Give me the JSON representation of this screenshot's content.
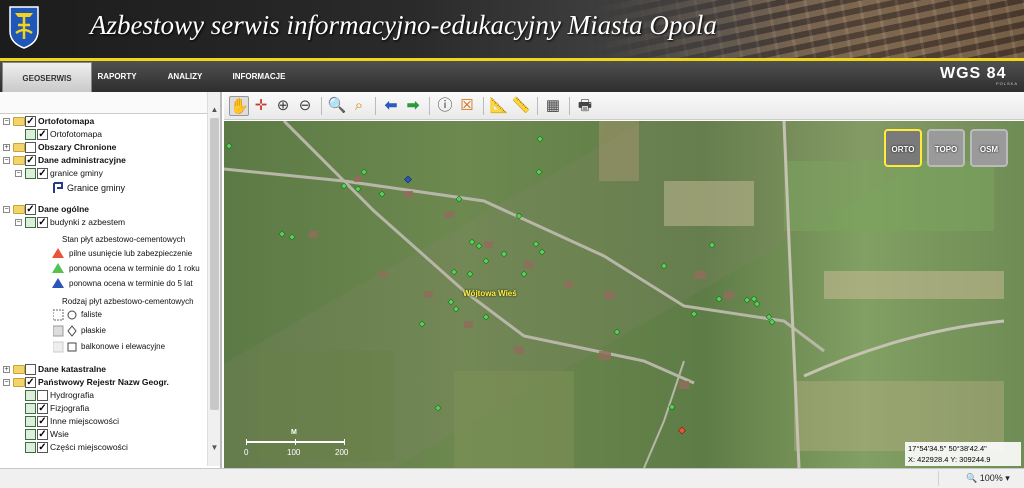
{
  "header": {
    "title": "Azbestowy serwis informacyjno-edukacyjny Miasta Opola"
  },
  "nav": {
    "tabs": [
      "GEOSERWIS",
      "RAPORTY",
      "ANALIZY",
      "INFORMACJE"
    ],
    "active": "GEOSERWIS"
  },
  "brand": {
    "name": "WGS 84",
    "sub": "POLSKA"
  },
  "layers": {
    "ortofotomapa": "Ortofotomapa",
    "ortofotomapa_child": "Ortofotomapa",
    "obszary": "Obszary Chronione",
    "dane_adm": "Dane administracyjne",
    "granice": "granice gminy",
    "granice_legend": "Granice gminy",
    "dane_ogolne": "Dane ogólne",
    "budynki": "budynki z azbestem",
    "dane_kat": "Dane katastralne",
    "prng": "Państwowy Rejestr Nazw Geogr.",
    "hydrografia": "Hydrografia",
    "fizjografia": "Fizjografia",
    "inne": "Inne miejscowości",
    "wsie": "Wsie",
    "czesci": "Części miejscowości"
  },
  "legend": {
    "stan_title": "Stan płyt azbestowo-cementowych",
    "stan_items": [
      {
        "label": "pilne usunięcie lub zabezpieczenie",
        "color": "#e8563a"
      },
      {
        "label": "ponowna ocena w terminie do 1 roku",
        "color": "#53c24f"
      },
      {
        "label": "ponowna ocena w terminie do 5 lat",
        "color": "#2a56b8"
      }
    ],
    "rodzaj_title": "Rodzaj płyt azbestowo-cementowych",
    "rodzaj_items": [
      "faliste",
      "płaskie",
      "balkonowe i elewacyjne"
    ]
  },
  "toolbar": {
    "icons": [
      "pan-icon",
      "full-extent-icon",
      "zoom-in-icon",
      "zoom-out-icon",
      "zoom-region-icon",
      "zoom-window-icon",
      "back-icon",
      "forward-icon",
      "info-icon",
      "clear-icon",
      "measure-icon",
      "measure-area-icon",
      "table-icon",
      "print-icon"
    ]
  },
  "map": {
    "basemaps": [
      "ORTO",
      "TOPO",
      "OSM"
    ],
    "active_basemap": "ORTO",
    "placename": "Wójtowa Wieś",
    "coords_line1": "17°54'34.5\" 50°38'42.4\"",
    "coords_line2": "X: 422928.4 Y: 309244.9",
    "scale_unit": "M",
    "scale_labels": [
      "0",
      "100",
      "200"
    ]
  },
  "status": {
    "zoom": "100%"
  }
}
